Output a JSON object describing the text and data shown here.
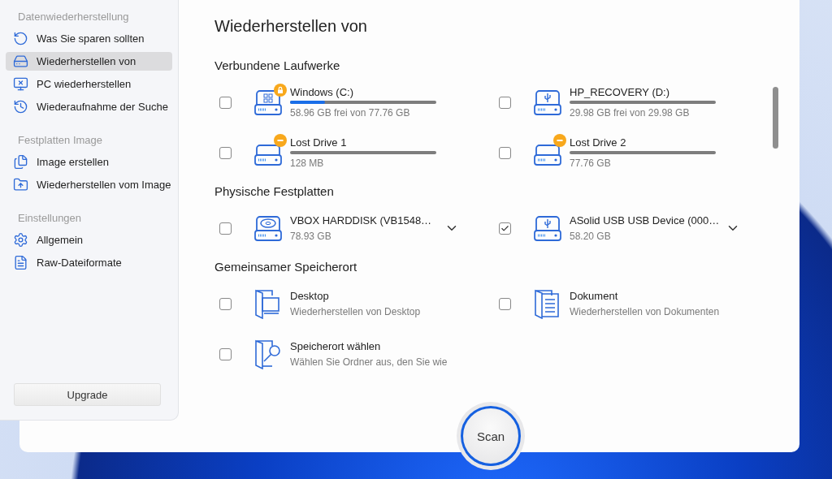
{
  "sidebar": {
    "sections": [
      {
        "heading": "Datenwiederherstellung",
        "items": [
          {
            "label": "Was Sie sparen sollten",
            "selected": false
          },
          {
            "label": "Wiederherstellen von",
            "selected": true
          },
          {
            "label": "PC wiederherstellen",
            "selected": false
          },
          {
            "label": "Wiederaufnahme der Suche",
            "selected": false
          }
        ]
      },
      {
        "heading": "Festplatten Image",
        "items": [
          {
            "label": "Image erstellen",
            "selected": false
          },
          {
            "label": "Wiederherstellen vom Image",
            "selected": false
          }
        ]
      },
      {
        "heading": "Einstellungen",
        "items": [
          {
            "label": "Allgemein",
            "selected": false
          },
          {
            "label": "Raw-Dateiformate",
            "selected": false
          }
        ]
      }
    ],
    "upgrade_button": "Upgrade"
  },
  "title": "Wiederherstellen von",
  "sections": [
    {
      "heading": "Verbundene Laufwerke",
      "items": [
        {
          "kind": "windows",
          "locked": true,
          "usage_bar": true,
          "name": "Windows (C:)",
          "detail": "58.96 GB frei von 77.76 GB",
          "level": 0.24,
          "checked": false,
          "expandable": false
        },
        {
          "kind": "usb",
          "locked": false,
          "usage_bar": true,
          "name": "HP_RECOVERY (D:)",
          "detail": "29.98 GB frei von 29.98 GB",
          "checked": false,
          "expandable": false
        },
        {
          "kind": "lost",
          "locked": false,
          "usage_bar": true,
          "name": "Lost Drive 1",
          "detail": "128 MB",
          "checked": false,
          "expandable": false
        },
        {
          "kind": "lost",
          "locked": false,
          "usage_bar": true,
          "name": "Lost Drive 2",
          "detail": "77.76 GB",
          "checked": false,
          "expandable": false
        }
      ]
    },
    {
      "heading": "Physische Festplatten",
      "items": [
        {
          "kind": "hdd",
          "locked": false,
          "usage_bar": false,
          "name": "VBOX HARDDISK (VB1548…",
          "detail": "78.93 GB",
          "checked": false,
          "expandable": true
        },
        {
          "kind": "usb",
          "locked": false,
          "usage_bar": false,
          "name": "ASolid USB USB Device (000…",
          "detail": "58.20 GB",
          "checked": true,
          "expandable": true
        }
      ]
    },
    {
      "heading": "Gemeinsamer Speicherort",
      "items": [
        {
          "kind": "desktop",
          "locked": false,
          "usage_bar": false,
          "name": "Desktop",
          "detail": "Wiederherstellen von Desktop",
          "checked": false,
          "expandable": false
        },
        {
          "kind": "document",
          "locked": false,
          "usage_bar": false,
          "name": "Dokument",
          "detail": "Wiederherstellen von Dokumenten",
          "checked": false,
          "expandable": false
        },
        {
          "kind": "folder-search",
          "locked": false,
          "usage_bar": false,
          "name": "Speicherort wählen",
          "detail": "Wählen Sie Ordner aus, den Sie wie",
          "checked": false,
          "expandable": false
        }
      ]
    }
  ],
  "scan_button": "Scan"
}
